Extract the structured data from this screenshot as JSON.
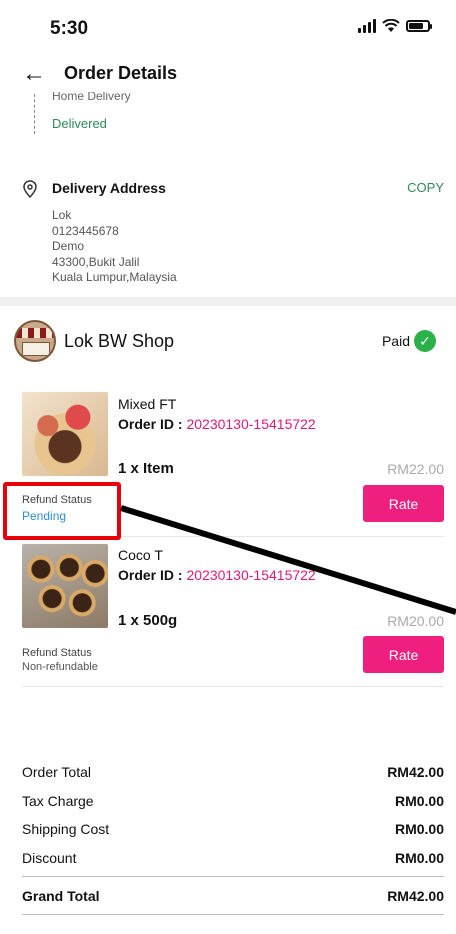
{
  "status_bar": {
    "time": "5:30"
  },
  "header": {
    "title": "Order Details"
  },
  "delivery": {
    "cut_label": "Home Delivery",
    "status": "Delivered"
  },
  "address": {
    "title": "Delivery Address",
    "copy_label": "COPY",
    "lines": [
      "Lok",
      "0123445678",
      "Demo",
      "43300,Bukit Jalil",
      "Kuala Lumpur,Malaysia"
    ]
  },
  "shop": {
    "name": "Lok BW Shop",
    "payment_status": "Paid"
  },
  "items": [
    {
      "name": "Mixed FT",
      "order_id_label": "Order ID :",
      "order_id": "20230130-15415722",
      "quantity": "1 x Item",
      "price": "RM22.00",
      "refund_label": "Refund Status",
      "refund_status": "Pending",
      "button_label": "Rate"
    },
    {
      "name": "Coco T",
      "order_id_label": "Order ID :",
      "order_id": "20230130-15415722",
      "quantity": "1 x 500g",
      "price": "RM20.00",
      "refund_label": "Refund Status",
      "refund_status": "Non-refundable",
      "button_label": "Rate"
    }
  ],
  "summary": {
    "rows": [
      {
        "label": "Order Total",
        "value": "RM42.00"
      },
      {
        "label": "Tax Charge",
        "value": "RM0.00"
      },
      {
        "label": "Shipping Cost",
        "value": "RM0.00"
      },
      {
        "label": "Discount",
        "value": "RM0.00"
      }
    ],
    "grand_total_label": "Grand Total",
    "grand_total_value": "RM42.00"
  },
  "colors": {
    "accent": "#ee1f7e",
    "success": "#2e8b57",
    "pending": "#2a8fd6",
    "annotation": "#e8000a"
  }
}
